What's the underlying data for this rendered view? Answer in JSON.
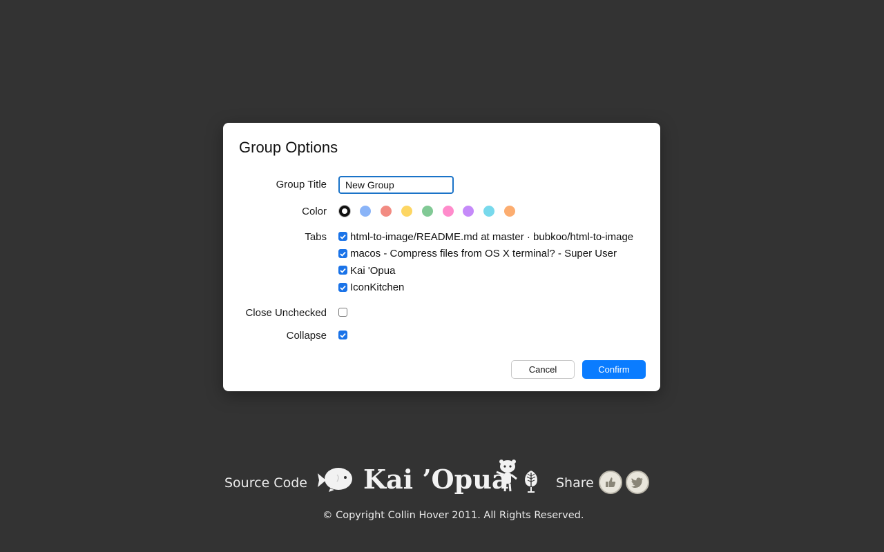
{
  "dialog": {
    "title": "Group Options",
    "group_title_label": "Group Title",
    "group_title_value": "New Group",
    "color_label": "Color",
    "colors": [
      "#ffffff",
      "#8ab4f8",
      "#f28b82",
      "#fdd663",
      "#81c995",
      "#ff8bcb",
      "#c58af9",
      "#78d9ec",
      "#fcad70"
    ],
    "selected_color_index": 0,
    "tabs_label": "Tabs",
    "tabs": [
      {
        "title": "html-to-image/README.md at master · bubkoo/html-to-image",
        "checked": true
      },
      {
        "title": "macos - Compress files from OS X terminal? - Super User",
        "checked": true
      },
      {
        "title": "Kai 'Opua",
        "checked": true
      },
      {
        "title": "IconKitchen",
        "checked": true
      }
    ],
    "close_unchecked_label": "Close Unchecked",
    "close_unchecked_checked": false,
    "collapse_label": "Collapse",
    "collapse_checked": true,
    "cancel_label": "Cancel",
    "confirm_label": "Confirm"
  },
  "footer": {
    "source_code_label": "Source Code",
    "brand_name": "Kai ’Opua",
    "share_label": "Share",
    "share_icons": [
      "thumbs-up-icon",
      "twitter-bird-icon"
    ],
    "copyright": "© Copyright Collin Hover 2011. All Rights Reserved."
  }
}
